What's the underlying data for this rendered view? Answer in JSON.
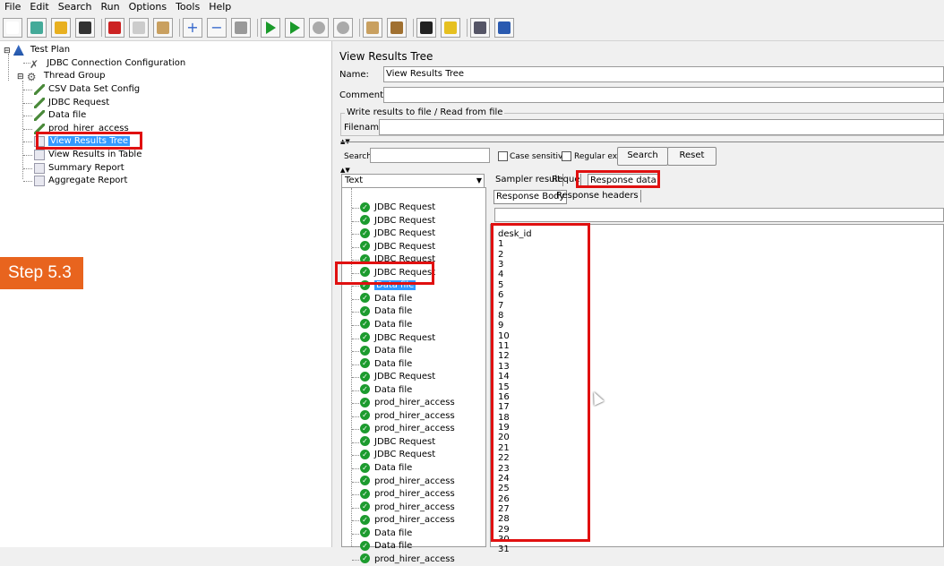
{
  "menu": [
    "File",
    "Edit",
    "Search",
    "Run",
    "Options",
    "Tools",
    "Help"
  ],
  "toolbar_icons": [
    "new-icon",
    "templates-icon",
    "open-icon",
    "save-icon",
    "cut-icon",
    "copy-icon",
    "paste-icon",
    "expand-icon",
    "collapse-icon",
    "toggle-icon",
    "start-icon",
    "start-no-pause-icon",
    "stop-icon",
    "shutdown-icon",
    "clear-icon",
    "clear-all-icon",
    "search-icon",
    "reset-search-icon",
    "function-helper-icon",
    "help-icon"
  ],
  "tree": {
    "root": "Test Plan",
    "jdbc_config": "JDBC Connection Configuration",
    "thread_group": "Thread Group",
    "children": [
      "CSV Data Set Config",
      "JDBC Request",
      "Data file",
      "prod_hirer_access",
      "View Results Tree",
      "View Results in Table",
      "Summary Report",
      "Aggregate Report"
    ],
    "selected": "View Results Tree"
  },
  "step_badge": "Step 5.3",
  "panel": {
    "title": "View Results Tree",
    "name_label": "Name:",
    "name_value": "View Results Tree",
    "comments_label": "Comments:",
    "write_group": "Write results to file / Read from file",
    "filename_label": "Filename",
    "search_label": "Search:",
    "case_sensitive": "Case sensitive",
    "regular_exp": "Regular exp.",
    "search_button": "Search",
    "reset_button": "Reset",
    "renderer": "Text"
  },
  "results": [
    "JDBC Request",
    "JDBC Request",
    "JDBC Request",
    "JDBC Request",
    "JDBC Request",
    "JDBC Request",
    "Data file",
    "Data file",
    "Data file",
    "Data file",
    "JDBC Request",
    "Data file",
    "Data file",
    "JDBC Request",
    "Data file",
    "prod_hirer_access",
    "prod_hirer_access",
    "prod_hirer_access",
    "JDBC Request",
    "JDBC Request",
    "Data file",
    "prod_hirer_access",
    "prod_hirer_access",
    "prod_hirer_access",
    "prod_hirer_access",
    "Data file",
    "Data file",
    "prod_hirer_access"
  ],
  "selected_result_index": 6,
  "tabs": [
    "Sampler result",
    "Request",
    "Response data"
  ],
  "subtabs": [
    "Response Body",
    "Response headers"
  ],
  "response_data": [
    "desk_id",
    "1",
    "2",
    "3",
    "4",
    "5",
    "6",
    "7",
    "8",
    "9",
    "10",
    "11",
    "12",
    "13",
    "14",
    "15",
    "16",
    "17",
    "18",
    "19",
    "20",
    "21",
    "22",
    "23",
    "24",
    "25",
    "26",
    "27",
    "28",
    "29",
    "30",
    "31"
  ]
}
